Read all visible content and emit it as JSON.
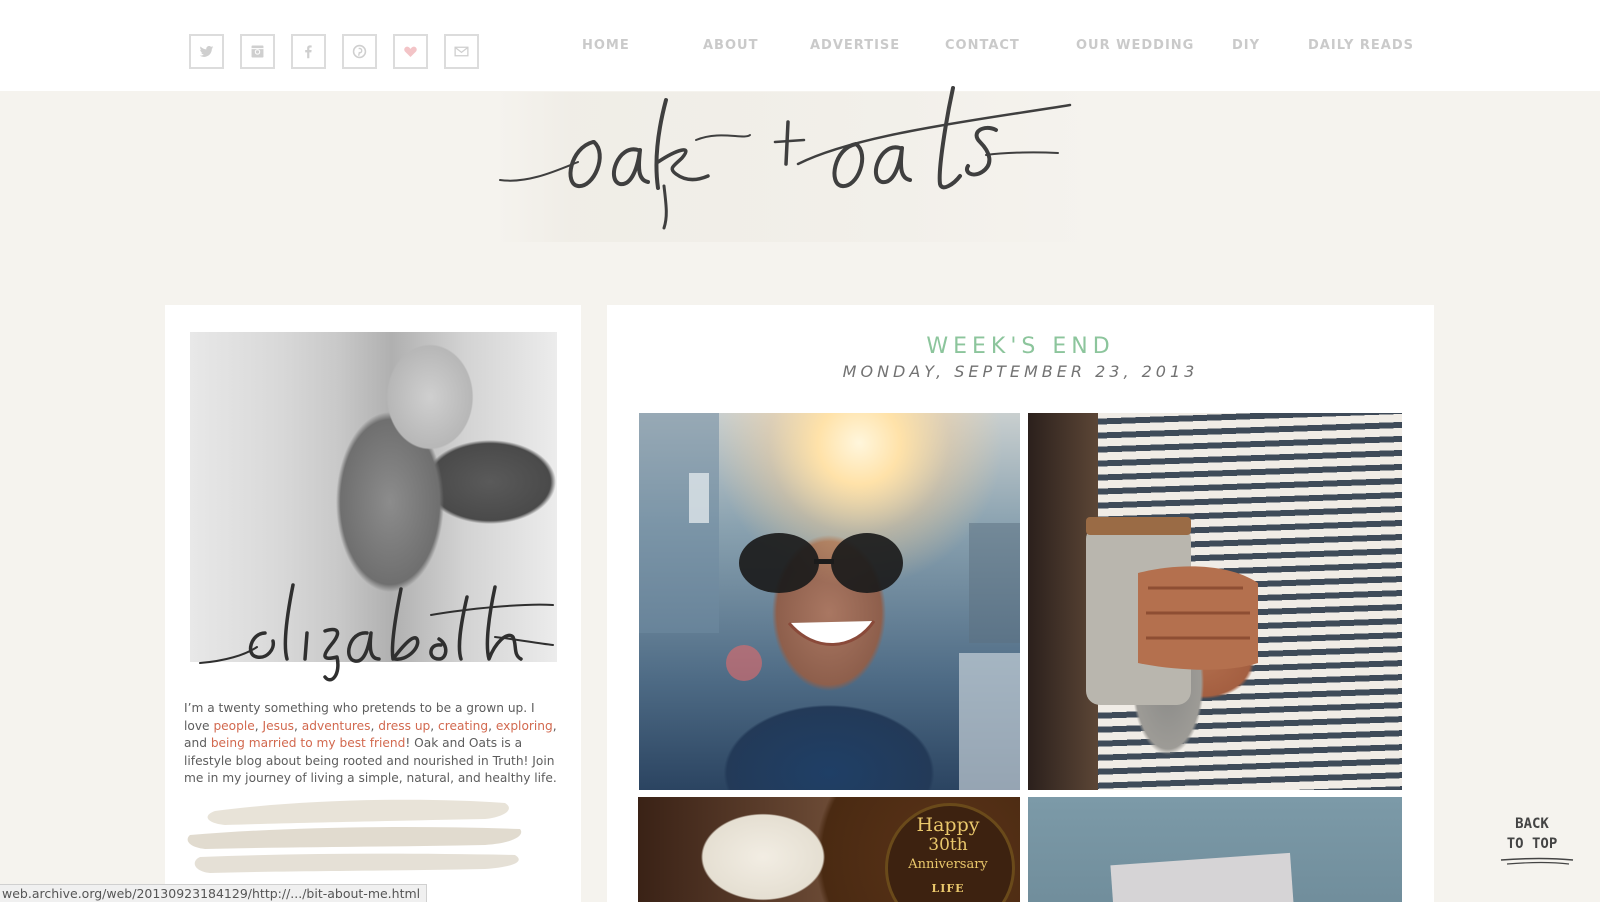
{
  "nav": {
    "social": [
      "twitter-icon",
      "instagram-icon",
      "facebook-icon",
      "pinterest-icon",
      "heart-icon",
      "email-icon"
    ],
    "links": [
      "HOME",
      "ABOUT",
      "ADVERTISE",
      "CONTACT",
      "OUR WEDDING",
      "DIY",
      "DAILY READS"
    ]
  },
  "logo": {
    "text": "oak + oats"
  },
  "sidebar": {
    "signature": "elizabeth",
    "bio_intro": "I’m a twenty something who pretends to be a grown up. I love ",
    "links": [
      "people",
      "Jesus",
      "adventures",
      "dress up",
      "creating",
      "exploring",
      "being married to my best friend"
    ],
    "sep": ", ",
    "and": ", and ",
    "bio_rest": "! Oak and Oats is a lifestyle blog about being rooted and nourished in Truth! Join me in my journey of living a simple, natural, and healthy life."
  },
  "post": {
    "title": "WEEK'S END",
    "date": "MONDAY, SEPTEMBER 23, 2013",
    "photo3_caption": [
      "Happy",
      "30th",
      "Anniversary",
      "LIFE NETWORK"
    ]
  },
  "back_to_top": [
    "BACK",
    "TO TOP"
  ],
  "status_url": "web.archive.org/web/20130923184129/http://.../bit-about-me.html",
  "colors": {
    "accent_green": "#8cc59c",
    "link_coral": "#d2694f",
    "page_bg": "#f5f3ee"
  }
}
